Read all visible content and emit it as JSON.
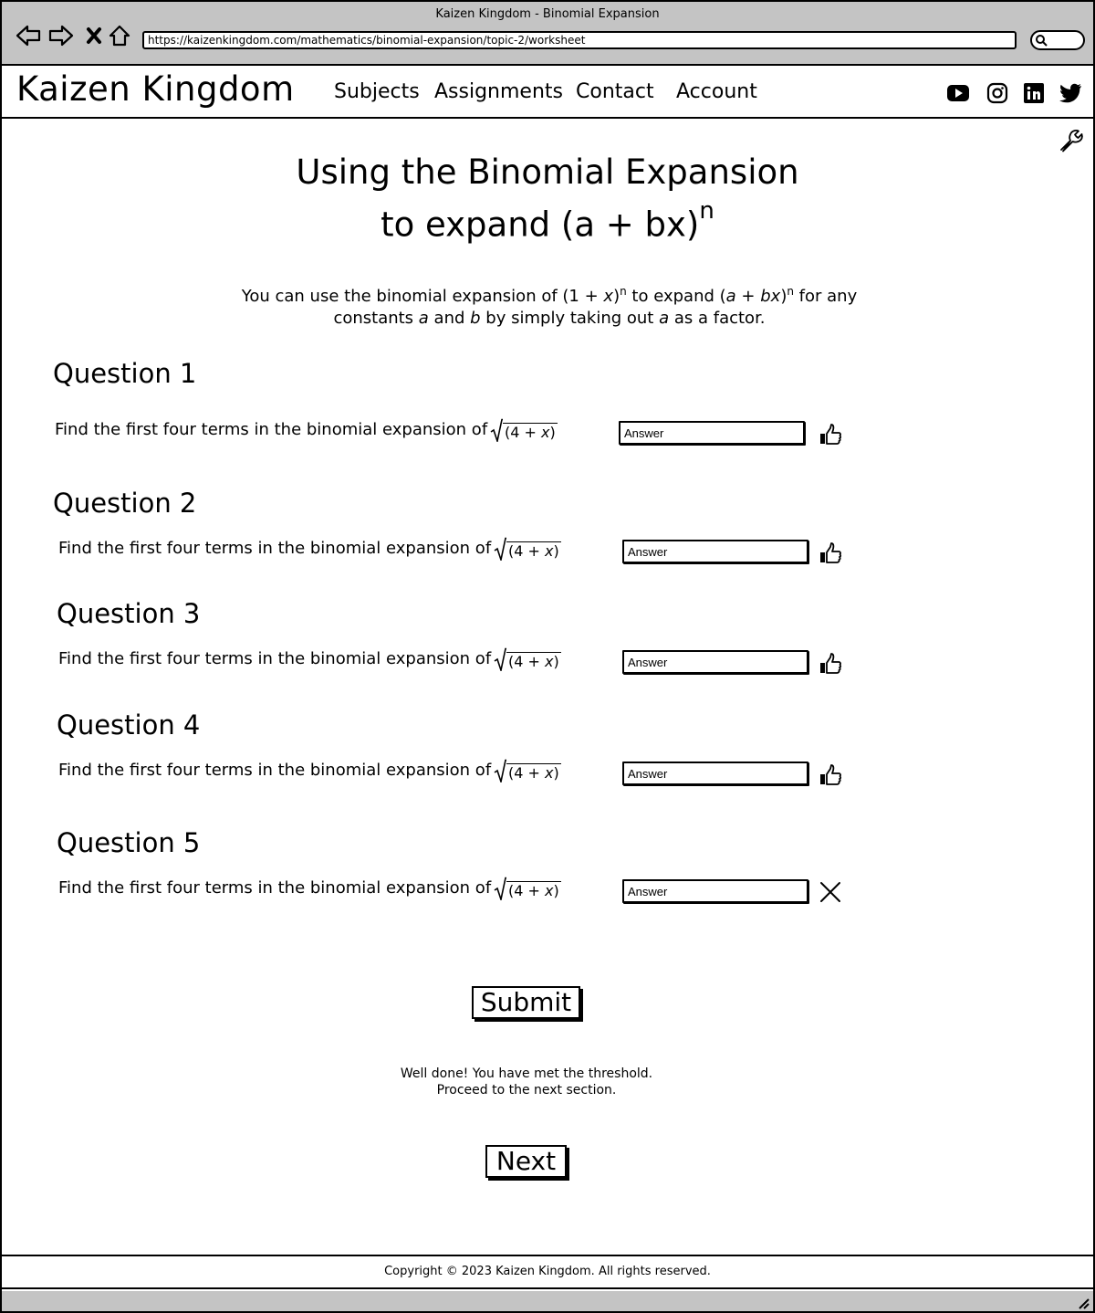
{
  "browser": {
    "window_title": "Kaizen Kingdom - Binomial Expansion",
    "url": "https://kaizenkingdom.com/mathematics/binomial-expansion/topic-2/worksheet",
    "icons": [
      "back-icon",
      "forward-icon",
      "stop-icon",
      "home-icon",
      "search-icon"
    ]
  },
  "header": {
    "logo": "Kaizen Kingdom",
    "nav": [
      "Subjects",
      "Assignments",
      "Contact",
      "Account"
    ],
    "social": [
      "youtube-icon",
      "instagram-icon",
      "linkedin-icon",
      "twitter-icon"
    ]
  },
  "page": {
    "title_line1": "Using the Binomial Expansion",
    "title_line2": "to expand (a + bx)",
    "title_sup": "n",
    "intro": {
      "p1": "You can use the binomial expansion of (1 + ",
      "x": "x",
      "p2": ")",
      "sup1": "n",
      "p3": " to expand (",
      "a": "a",
      "p4": " + ",
      "bx": "bx",
      "p5": ")",
      "sup2": "n",
      "p6": " for any",
      "p7": "constants ",
      "a2": "a",
      "p8": " and ",
      "b": "b",
      "p9": " by simply taking out ",
      "a3": "a",
      "p10": " as a factor."
    }
  },
  "questions": [
    {
      "heading": "Question 1",
      "text": "Find the first four terms in the binomial expansion of",
      "expr_a": "(4 + ",
      "expr_x": "x",
      "expr_b": ")",
      "answer_placeholder": "Answer",
      "result": "thumbs-up-icon"
    },
    {
      "heading": "Question 2",
      "text": "Find the first four terms in the binomial expansion of",
      "expr_a": "(4 + ",
      "expr_x": "x",
      "expr_b": ")",
      "answer_placeholder": "Answer",
      "result": "thumbs-up-icon"
    },
    {
      "heading": "Question 3",
      "text": "Find the first four terms in the binomial expansion of",
      "expr_a": "(4 + ",
      "expr_x": "x",
      "expr_b": ")",
      "answer_placeholder": "Answer",
      "result": "thumbs-up-icon"
    },
    {
      "heading": "Question 4",
      "text": "Find the first four terms in the binomial expansion of",
      "expr_a": "(4 + ",
      "expr_x": "x",
      "expr_b": ")",
      "answer_placeholder": "Answer",
      "result": "thumbs-up-icon"
    },
    {
      "heading": "Question 5",
      "text": "Find the first four terms in the binomial expansion of",
      "expr_a": "(4 + ",
      "expr_x": "x",
      "expr_b": ")",
      "answer_placeholder": "Answer",
      "result": "cross-icon"
    }
  ],
  "actions": {
    "submit": "Submit",
    "message_line1": "Well done! You have met the threshold.",
    "message_line2": "Proceed to the next section.",
    "next": "Next"
  },
  "footer": {
    "copyright": "Copyright © 2023 Kaizen Kingdom. All rights reserved."
  }
}
